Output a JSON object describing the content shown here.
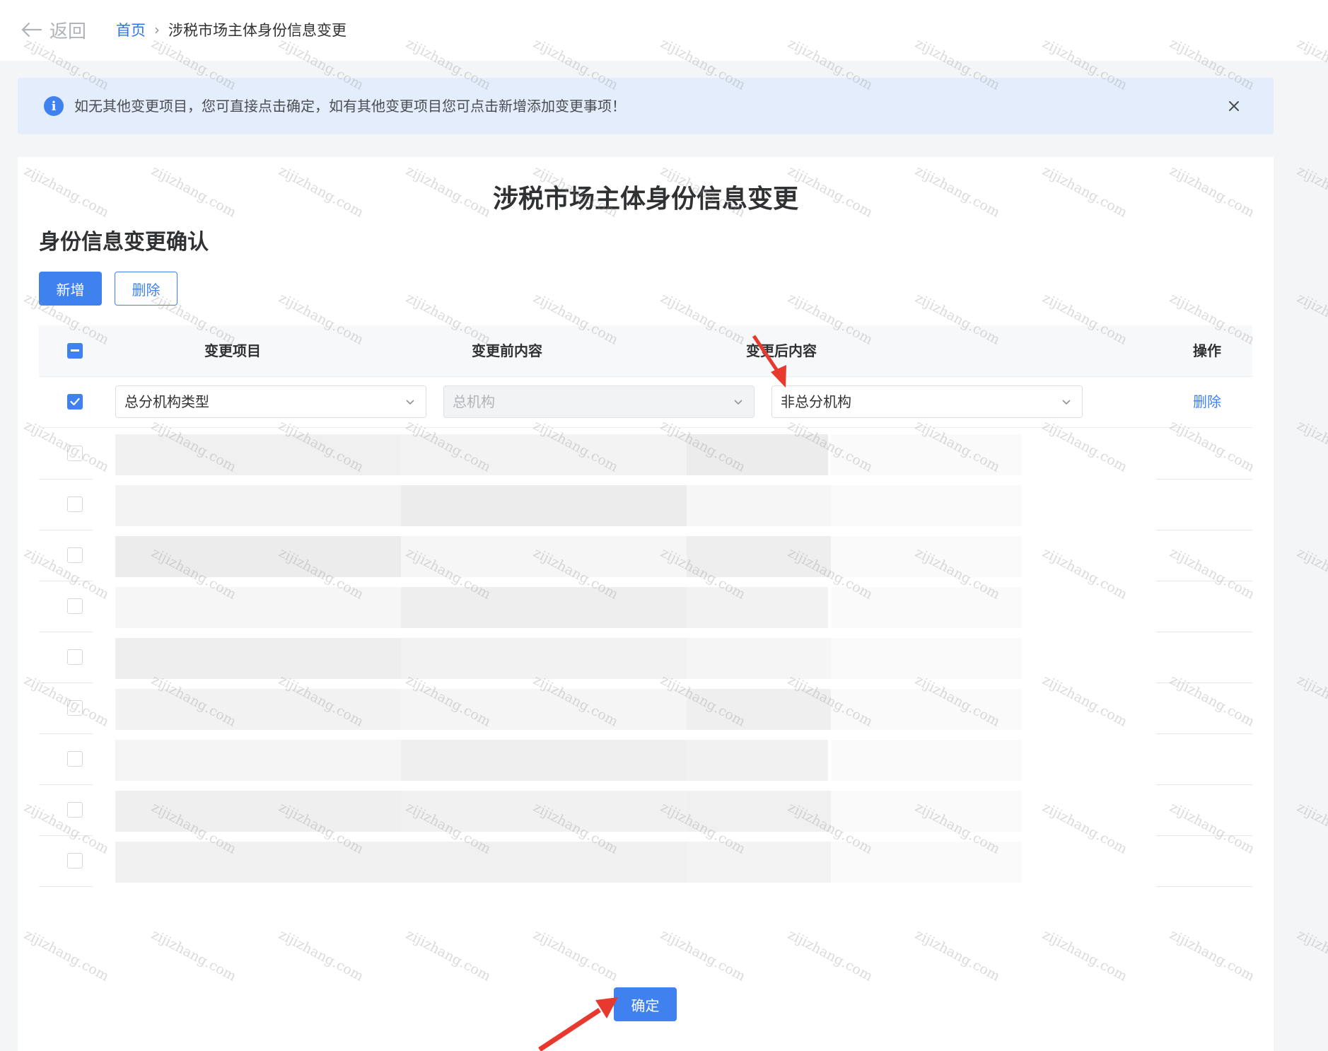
{
  "header": {
    "back_label": "返回",
    "breadcrumb_home": "首页",
    "breadcrumb_separator": "›",
    "breadcrumb_current": "涉税市场主体身份信息变更"
  },
  "alert": {
    "text": "如无其他变更项目，您可直接点击确定，如有其他变更项目您可点击新增添加变更事项！",
    "icon": "info-icon",
    "close_icon": "close-icon"
  },
  "page": {
    "title": "涉税市场主体身份信息变更",
    "section_title": "身份信息变更确认"
  },
  "toolbar": {
    "add_label": "新增",
    "delete_label": "删除"
  },
  "table": {
    "headers": [
      "变更项目",
      "变更前内容",
      "变更后内容",
      "操作"
    ],
    "rows": [
      {
        "checked": true,
        "item": "总分机构类型",
        "before": "总机构",
        "before_disabled": true,
        "after": "非总分机构",
        "action": "删除"
      }
    ],
    "blurred_row_count": 9
  },
  "footer": {
    "confirm_label": "确定"
  },
  "watermark": {
    "text": "zijizhang.com"
  },
  "colors": {
    "primary": "#3f82ef",
    "alert_bg": "#e4edfc",
    "annotation_arrow": "#e8392f"
  }
}
